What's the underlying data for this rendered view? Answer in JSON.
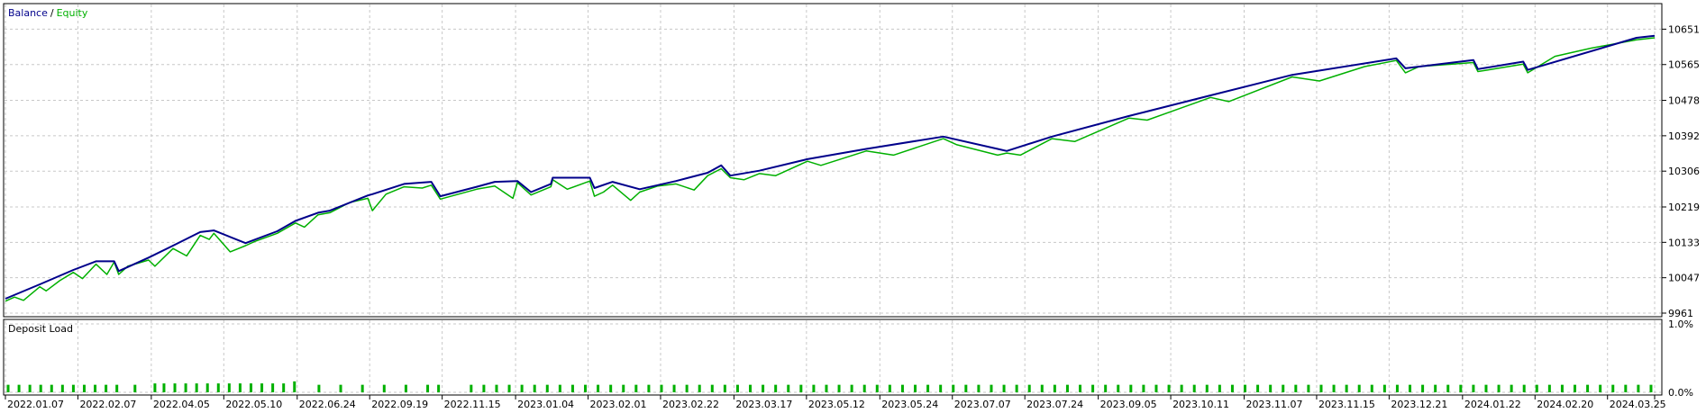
{
  "chart_data": [
    {
      "type": "line",
      "legend": [
        "Balance",
        "Equity"
      ],
      "legend_separator": "/",
      "legend_placement": "top-left",
      "ylim": [
        9961,
        10700
      ],
      "y_ticks": [
        9961,
        10047,
        10133,
        10219,
        10306,
        10392,
        10478,
        10565,
        10651
      ],
      "grid": true,
      "series": [
        {
          "name": "Balance",
          "color": "#00008b",
          "x_index": [
            0,
            38,
            75,
            100,
            120,
            125,
            158,
            185,
            215,
            230,
            265,
            300,
            320,
            345,
            358,
            400,
            405,
            440,
            470,
            480,
            520,
            540,
            565,
            580,
            602,
            604,
            645,
            650,
            670,
            700,
            740,
            775,
            790,
            800,
            832,
            885,
            950,
            1035,
            1095,
            1105,
            1155,
            1240,
            1330,
            1420,
            1535,
            1545,
            1620,
            1625,
            1675,
            1680,
            1800,
            1820
          ],
          "values": [
            9996,
            10031,
            10066,
            10087,
            10087,
            10063,
            10096,
            10125,
            10158,
            10162,
            10131,
            10160,
            10185,
            10205,
            10210,
            10247,
            10250,
            10275,
            10280,
            10245,
            10268,
            10280,
            10282,
            10255,
            10275,
            10290,
            10290,
            10265,
            10280,
            10262,
            10282,
            10302,
            10320,
            10295,
            10307,
            10335,
            10360,
            10390,
            10360,
            10355,
            10390,
            10440,
            10490,
            10540,
            10580,
            10556,
            10576,
            10554,
            10572,
            10552,
            10630,
            10635
          ]
        },
        {
          "name": "Equity",
          "color": "#00b000",
          "x_index": [
            0,
            10,
            20,
            38,
            45,
            60,
            75,
            85,
            100,
            112,
            120,
            125,
            135,
            158,
            165,
            185,
            200,
            215,
            225,
            230,
            248,
            265,
            275,
            300,
            320,
            330,
            345,
            358,
            380,
            400,
            405,
            420,
            440,
            460,
            470,
            480,
            500,
            520,
            540,
            560,
            565,
            580,
            602,
            604,
            620,
            645,
            650,
            660,
            670,
            690,
            700,
            720,
            740,
            760,
            775,
            790,
            800,
            815,
            832,
            850,
            885,
            900,
            950,
            980,
            1035,
            1050,
            1095,
            1105,
            1120,
            1155,
            1180,
            1240,
            1260,
            1330,
            1350,
            1420,
            1450,
            1500,
            1535,
            1545,
            1560,
            1620,
            1625,
            1645,
            1675,
            1680,
            1710,
            1750,
            1800,
            1820
          ],
          "values": [
            9990,
            10000,
            9992,
            10025,
            10015,
            10040,
            10060,
            10045,
            10080,
            10055,
            10085,
            10055,
            10075,
            10090,
            10075,
            10118,
            10100,
            10150,
            10140,
            10155,
            10110,
            10125,
            10135,
            10155,
            10180,
            10170,
            10200,
            10205,
            10230,
            10240,
            10210,
            10250,
            10268,
            10265,
            10272,
            10238,
            10250,
            10262,
            10270,
            10240,
            10278,
            10248,
            10268,
            10285,
            10262,
            10282,
            10245,
            10255,
            10272,
            10235,
            10255,
            10270,
            10275,
            10260,
            10295,
            10312,
            10290,
            10285,
            10300,
            10295,
            10330,
            10320,
            10355,
            10345,
            10385,
            10370,
            10345,
            10350,
            10345,
            10385,
            10378,
            10435,
            10430,
            10485,
            10475,
            10535,
            10525,
            10560,
            10575,
            10545,
            10560,
            10570,
            10548,
            10555,
            10566,
            10545,
            10585,
            10605,
            10625,
            10630
          ]
        }
      ]
    },
    {
      "type": "bar",
      "title": "Deposit Load",
      "legend_placement": "top-left",
      "ylim": [
        0,
        1.0
      ],
      "y_ticks": [
        "1.0%",
        "0.0%"
      ],
      "color": "#00b000",
      "grid": true,
      "bar_index": [
        3,
        15,
        27,
        39,
        51,
        63,
        75,
        87,
        99,
        111,
        123,
        143,
        165,
        175,
        187,
        199,
        211,
        223,
        235,
        247,
        259,
        271,
        283,
        295,
        307,
        319,
        346,
        370,
        394,
        418,
        442,
        466,
        478,
        514,
        528,
        542,
        556,
        570,
        584,
        598,
        612,
        626,
        640,
        654,
        668,
        682,
        696,
        710,
        724,
        738,
        752,
        766,
        780,
        794,
        808,
        822,
        836,
        850,
        864,
        878,
        892,
        906,
        920,
        934,
        948,
        962,
        976,
        990,
        1004,
        1018,
        1032,
        1046,
        1060,
        1074,
        1088,
        1102,
        1116,
        1130,
        1144,
        1158,
        1172,
        1186,
        1200,
        1214,
        1228,
        1242,
        1256,
        1270,
        1284,
        1298,
        1312,
        1326,
        1340,
        1354,
        1368,
        1382,
        1396,
        1410,
        1424,
        1438,
        1452,
        1466,
        1480,
        1494,
        1508,
        1522,
        1536,
        1550,
        1564,
        1578,
        1592,
        1606,
        1620,
        1634,
        1648,
        1662,
        1676,
        1690,
        1704,
        1718,
        1732,
        1746,
        1760,
        1774,
        1788,
        1802,
        1816
      ],
      "values": [
        0.11,
        0.11,
        0.11,
        0.11,
        0.11,
        0.11,
        0.11,
        0.11,
        0.11,
        0.11,
        0.11,
        0.11,
        0.13,
        0.13,
        0.13,
        0.13,
        0.13,
        0.13,
        0.13,
        0.13,
        0.13,
        0.13,
        0.13,
        0.13,
        0.13,
        0.16,
        0.11,
        0.11,
        0.11,
        0.11,
        0.11,
        0.11,
        0.11,
        0.11,
        0.11,
        0.11,
        0.11,
        0.11,
        0.11,
        0.11,
        0.11,
        0.11,
        0.11,
        0.11,
        0.11,
        0.11,
        0.11,
        0.11,
        0.11,
        0.11,
        0.11,
        0.11,
        0.11,
        0.11,
        0.11,
        0.11,
        0.11,
        0.11,
        0.11,
        0.11,
        0.11,
        0.11,
        0.11,
        0.11,
        0.11,
        0.11,
        0.11,
        0.11,
        0.11,
        0.11,
        0.11,
        0.11,
        0.11,
        0.11,
        0.11,
        0.11,
        0.11,
        0.11,
        0.11,
        0.11,
        0.11,
        0.11,
        0.11,
        0.11,
        0.11,
        0.11,
        0.11,
        0.11,
        0.11,
        0.11,
        0.11,
        0.11,
        0.11,
        0.11,
        0.11,
        0.11,
        0.11,
        0.11,
        0.11,
        0.11,
        0.11,
        0.11,
        0.11,
        0.11,
        0.11,
        0.11,
        0.11,
        0.11,
        0.11,
        0.11,
        0.11,
        0.11,
        0.11,
        0.11,
        0.11,
        0.11,
        0.11,
        0.11,
        0.11,
        0.11,
        0.11,
        0.11,
        0.11,
        0.11,
        0.11,
        0.11,
        0.11
      ]
    }
  ],
  "x_axis": {
    "tick_index": [
      0,
      80,
      161,
      241,
      322,
      402,
      482,
      563,
      643,
      723,
      804,
      884,
      965,
      1045,
      1125,
      1206,
      1286,
      1367,
      1447,
      1527,
      1608,
      1688,
      1768,
      1820
    ],
    "labels": [
      "2022.01.07",
      "2022.02.07",
      "2022.04.05",
      "2022.05.10",
      "2022.06.24",
      "2022.09.19",
      "2022.11.15",
      "2023.01.04",
      "2023.02.01",
      "2023.02.22",
      "2023.03.17",
      "2023.05.12",
      "2023.05.24",
      "2023.07.07",
      "2023.07.24",
      "2023.09.05",
      "2023.10.11",
      "2023.11.07",
      "2023.11.15",
      "2023.12.21",
      "2024.01.22",
      "2024.02.20",
      "2024.03.25",
      ""
    ],
    "index_max": 1820
  },
  "colors": {
    "balance_legend": "#00008b",
    "equity_legend": "#00b000",
    "grid": "#c8c8c8",
    "frame": "#000000"
  }
}
